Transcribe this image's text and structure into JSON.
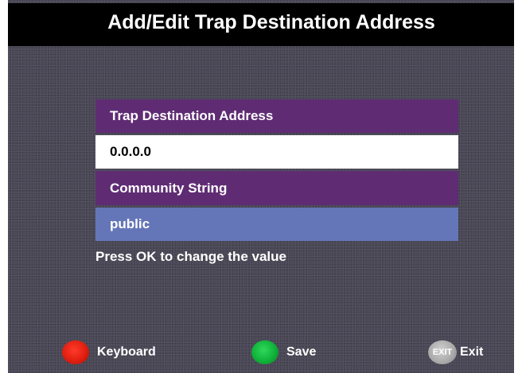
{
  "window": {
    "title": "Add/Edit Trap Destination Address"
  },
  "form": {
    "trap_label": "Trap Destination Address",
    "trap_value": "0.0.0.0",
    "community_label": "Community String",
    "community_value": "public",
    "hint": "Press OK to change the value"
  },
  "footer": {
    "keyboard_label": "Keyboard",
    "save_label": "Save",
    "exit_badge": "EXIT",
    "exit_label": "Exit"
  },
  "colors": {
    "label_row": "#5f2c74",
    "focus_row": "#6576b8",
    "background": "#4a4856",
    "red_button": "#e01f10",
    "green_button": "#10b23a",
    "exit_button": "#a9a9a9"
  }
}
